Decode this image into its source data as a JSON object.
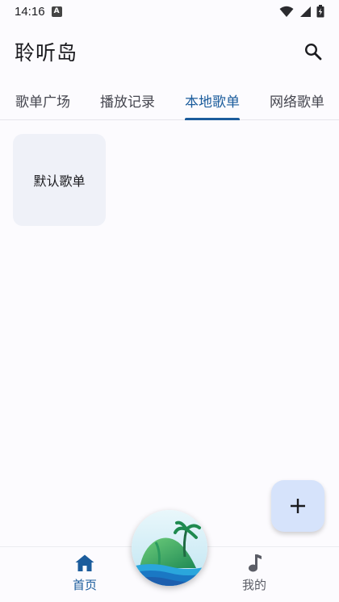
{
  "status_bar": {
    "time": "14:16",
    "a_badge": "A"
  },
  "app_bar": {
    "title": "聆听岛"
  },
  "tabs": [
    {
      "label": "歌单广场",
      "active": false
    },
    {
      "label": "播放记录",
      "active": false
    },
    {
      "label": "本地歌单",
      "active": true
    },
    {
      "label": "网络歌单",
      "active": false
    }
  ],
  "playlists": [
    {
      "name": "默认歌单"
    }
  ],
  "fab": {
    "icon": "plus-icon"
  },
  "bottom_nav": {
    "home_label": "首页",
    "mine_label": "我的"
  },
  "colors": {
    "accent": "#1b5c9c",
    "background": "#fcfbfe",
    "card": "#eff1f8",
    "fab": "#d6e3fb"
  }
}
